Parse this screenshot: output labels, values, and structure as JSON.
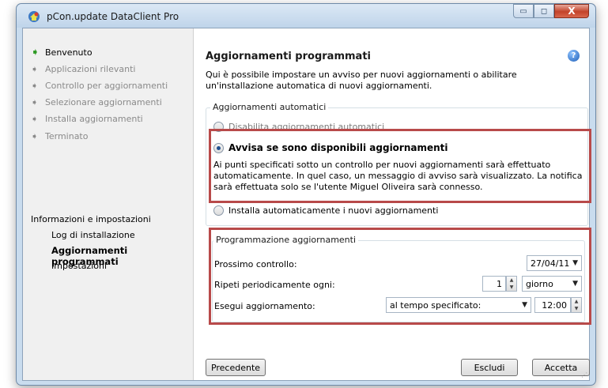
{
  "window": {
    "title": "pCon.update DataClient Pro",
    "controls": {
      "minimize": "▭",
      "maximize": "◻",
      "close": "X"
    }
  },
  "sidebar": {
    "steps": [
      {
        "label": "Benvenuto",
        "active": true
      },
      {
        "label": "Applicazioni rilevanti",
        "active": false
      },
      {
        "label": "Controllo per aggiornamenti",
        "active": false
      },
      {
        "label": "Selezionare aggiornamenti",
        "active": false
      },
      {
        "label": "Installa aggiornamenti",
        "active": false
      },
      {
        "label": "Terminato",
        "active": false
      }
    ],
    "info_header": "Informazioni e impostazioni",
    "info_items": [
      {
        "label": "Log di installazione"
      },
      {
        "label": "Aggiornamenti programmati",
        "selected": true
      },
      {
        "label": "Impostazioni"
      }
    ]
  },
  "main": {
    "title": "Aggiornamenti programmati",
    "help_icon": "?",
    "description": "Qui è possibile impostare un avviso per nuovi aggiornamenti o abilitare un'installazione automatica di nuovi aggiornamenti.",
    "auto_group": {
      "label": "Aggiornamenti automatici",
      "options": [
        {
          "label": "Disabilita aggiornamenti automatici",
          "checked": false
        },
        {
          "label": "Avvisa se sono disponibili aggiornamenti",
          "checked": true
        },
        {
          "label": "Installa automaticamente i nuovi aggiornamenti",
          "checked": false
        }
      ],
      "notice": "Ai punti specificati sotto un controllo per nuovi aggiornamenti sarà effettuato automaticamente. In quel caso, un messaggio di avviso sarà visualizzato. La notifica sarà effettuata solo se l'utente Miguel Oliveira sarà connesso."
    },
    "schedule_group": {
      "label": "Programmazione aggiornamenti",
      "next_check": {
        "label": "Prossimo controllo:",
        "value": "27/04/11"
      },
      "repeat": {
        "label": "Ripeti periodicamente ogni:",
        "count": "1",
        "unit": "giorno"
      },
      "run": {
        "label": "Esegui aggiornamento:",
        "mode": "al tempo specificato:",
        "time": "12:00"
      }
    },
    "buttons": {
      "back": "Precedente",
      "skip": "Escludi",
      "accept": "Accetta"
    }
  },
  "colors": {
    "highlight": "#b84a4a",
    "active_arrow": "#2e9a24"
  }
}
